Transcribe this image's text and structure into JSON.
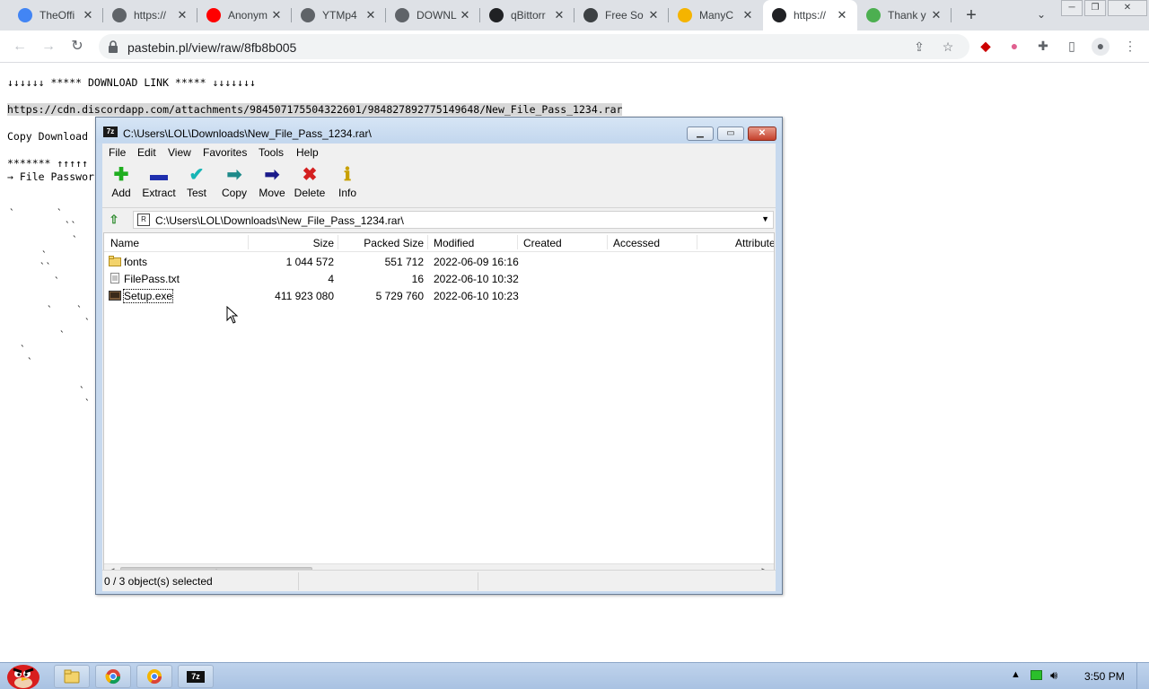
{
  "browser": {
    "tabs": [
      {
        "title": "TheOffi",
        "favicon_color": "#4285f4",
        "favicon": "G"
      },
      {
        "title": "https://",
        "favicon_color": "#5f6368",
        "favicon": "globe"
      },
      {
        "title": "Anonym",
        "favicon_color": "#ff0000",
        "favicon": "youtube"
      },
      {
        "title": "YTMp4",
        "favicon_color": "#5f6368",
        "favicon": "globe"
      },
      {
        "title": "DOWNL",
        "favicon_color": "#5f6368",
        "favicon": "globe"
      },
      {
        "title": "qBittorr",
        "favicon_color": "#202124",
        "favicon": "q"
      },
      {
        "title": "Free So",
        "favicon_color": "#3c4043",
        "favicon": "paw"
      },
      {
        "title": "ManyC",
        "favicon_color": "#f5b400",
        "favicon": "M"
      },
      {
        "title": "https://",
        "favicon_color": "#202124",
        "favicon": "terminal"
      },
      {
        "title": "Thank y",
        "favicon_color": "#4caf50",
        "favicon": "utorrent"
      }
    ],
    "active_tab_index": 8,
    "url": "pastebin.pl/view/raw/8fb8b005"
  },
  "page": {
    "line1": "↓↓↓↓↓↓ ***** DOWNLOAD LINK ***** ↓↓↓↓↓↓↓",
    "link": "https://cdn.discordapp.com/attachments/984507175504322601/984827892775149648/New_File_Pass_1234.rar",
    "line3": "Copy Download",
    "line4": "******* ↑↑↑↑↑",
    "line5": "→ File Passwor"
  },
  "zip": {
    "title": "C:\\Users\\LOL\\Downloads\\New_File_Pass_1234.rar\\",
    "menu": [
      "File",
      "Edit",
      "View",
      "Favorites",
      "Tools",
      "Help"
    ],
    "toolbar": [
      {
        "label": "Add",
        "icon": "add-icon",
        "color": "#1fae1f",
        "glyph": "✚"
      },
      {
        "label": "Extract",
        "icon": "extract-icon",
        "color": "#1f2fae",
        "glyph": "▬"
      },
      {
        "label": "Test",
        "icon": "test-icon",
        "color": "#16b5b5",
        "glyph": "✔"
      },
      {
        "label": "Copy",
        "icon": "copy-icon",
        "color": "#1e8a8a",
        "glyph": "➡"
      },
      {
        "label": "Move",
        "icon": "move-icon",
        "color": "#1a1a8a",
        "glyph": "➡"
      },
      {
        "label": "Delete",
        "icon": "delete-icon",
        "color": "#d42020",
        "glyph": "✖"
      },
      {
        "label": "Info",
        "icon": "info-icon",
        "color": "#c8a000",
        "glyph": "ℹ"
      }
    ],
    "path": "C:\\Users\\LOL\\Downloads\\New_File_Pass_1234.rar\\",
    "columns": [
      "Name",
      "Size",
      "Packed Size",
      "Modified",
      "Created",
      "Accessed",
      "Attributes"
    ],
    "files": [
      {
        "name": "fonts",
        "type": "folder",
        "size": "1 044 572",
        "packed": "551 712",
        "modified": "2022-06-09 16:16"
      },
      {
        "name": "FilePass.txt",
        "type": "text",
        "size": "4",
        "packed": "16",
        "modified": "2022-06-10 10:32"
      },
      {
        "name": "Setup.exe",
        "type": "exe",
        "size": "411 923 080",
        "packed": "5 729 760",
        "modified": "2022-06-10 10:23"
      }
    ],
    "status": "0 / 3 object(s) selected"
  },
  "taskbar": {
    "clock": "3:50 PM"
  }
}
